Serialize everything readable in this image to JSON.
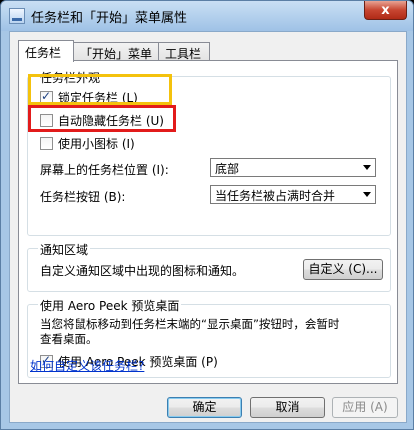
{
  "window": {
    "title": "任务栏和「开始」菜单属性",
    "close_label": "x"
  },
  "tabs": [
    {
      "label": "任务栏",
      "active": true
    },
    {
      "label": "「开始」菜单",
      "active": false
    },
    {
      "label": "工具栏",
      "active": false
    }
  ],
  "appearance": {
    "group_label": "任务栏外观",
    "lock_taskbar": {
      "label": "锁定任务栏 (L)",
      "checked": true
    },
    "auto_hide": {
      "label": "自动隐藏任务栏 (U)",
      "checked": false
    },
    "small_icons": {
      "label": "使用小图标 (I)",
      "checked": false
    },
    "location_label": "屏幕上的任务栏位置 (I):",
    "location_value": "底部",
    "buttons_label": "任务栏按钮 (B):",
    "buttons_value": "当任务栏被占满时合并"
  },
  "notification": {
    "group_label": "通知区域",
    "description": "自定义通知区域中出现的图标和通知。",
    "customize_button": "自定义 (C)..."
  },
  "aero_peek": {
    "group_label": "使用 Aero Peek 预览桌面",
    "description_line1": "当您将鼠标移动到任务栏末端的“显示桌面”按钮时，会暂时",
    "description_line2": "查看桌面。",
    "checkbox": {
      "label": "使用 Aero Peek 预览桌面 (P)",
      "checked": true
    }
  },
  "help_link": "如何自定义该任务栏?",
  "footer": {
    "ok": "确定",
    "cancel": "取消",
    "apply": "应用 (A)"
  },
  "highlight_colors": {
    "yellow": "#f4c20d",
    "red": "#e21b1b"
  }
}
